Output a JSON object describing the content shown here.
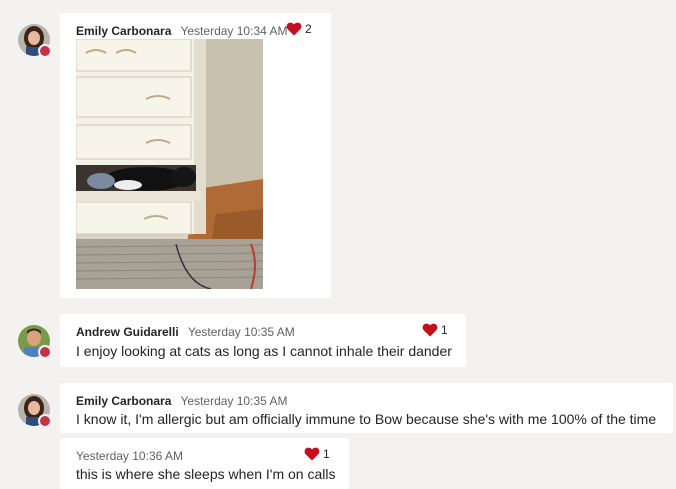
{
  "messages": [
    {
      "sender": "Emily Carbonara",
      "time": "Yesterday 10:34 AM",
      "reaction_count": "2",
      "attachment": "image",
      "image_alt": "Cat sleeping in a drawer"
    },
    {
      "sender": "Andrew Guidarelli",
      "time": "Yesterday 10:35 AM",
      "reaction_count": "1",
      "text": "I enjoy looking at cats as long as I cannot inhale their dander"
    },
    {
      "sender": "Emily Carbonara",
      "time": "Yesterday 10:35 AM",
      "text": "I know it, I'm allergic but am officially immune to Bow because she's with me 100% of the time"
    },
    {
      "sender": "",
      "time": "Yesterday 10:36 AM",
      "reaction_count": "1",
      "text": "this is where she sleeps when I'm on calls"
    }
  ],
  "reaction_icon": "heart-icon",
  "presence_status": "busy",
  "colors": {
    "background": "#f3f2f1",
    "card": "#ffffff",
    "heart": "#c50f1f",
    "presence": "#c4314b",
    "timestamp": "#616161"
  }
}
